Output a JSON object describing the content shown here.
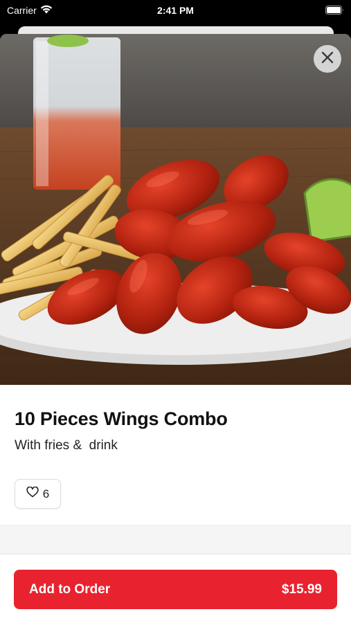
{
  "status_bar": {
    "carrier": "Carrier",
    "time": "2:41 PM"
  },
  "item": {
    "title": "10 Pieces Wings Combo",
    "subtitle": "With fries &  drink",
    "likes": "6"
  },
  "footer": {
    "add_label": "Add to Order",
    "price": "$15.99"
  },
  "colors": {
    "accent": "#e8232f"
  },
  "icons": {
    "close": "close-icon",
    "like": "heart-icon",
    "wifi": "wifi-icon",
    "battery": "battery-icon"
  }
}
